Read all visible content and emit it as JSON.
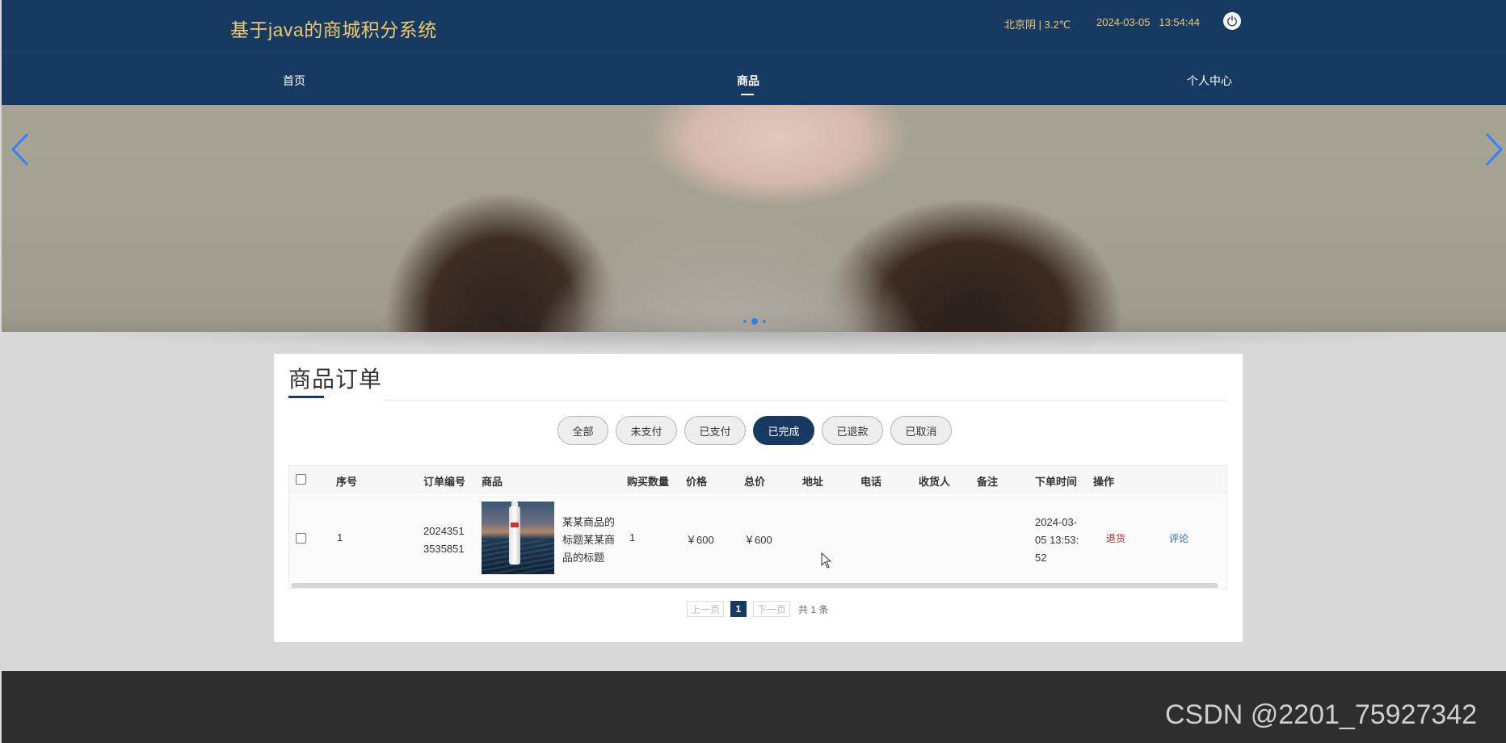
{
  "header": {
    "site_title": "基于java的商城积分系统",
    "weather": "北京阴 | 3.2℃",
    "datetime": "2024-03-05   13:54:44",
    "power_icon": "power-icon"
  },
  "nav": {
    "home": "首页",
    "goods": "商品",
    "user_center": "个人中心"
  },
  "banner": {
    "prev_icon": "chevron-left-icon",
    "next_icon": "chevron-right-icon",
    "slide_count": 3,
    "active_slide": 2
  },
  "orders": {
    "title": "商品订单",
    "filters": [
      "全部",
      "未支付",
      "已支付",
      "已完成",
      "已退款",
      "已取消"
    ],
    "active_filter": "已完成",
    "columns": [
      "序号",
      "订单编号",
      "商品",
      "购买数量",
      "价格",
      "总价",
      "地址",
      "电话",
      "收货人",
      "备注",
      "下单时间",
      "操作"
    ],
    "rows": [
      {
        "index": "1",
        "order_no_line1": "2024351",
        "order_no_line2": "3535851",
        "product_line1": "某某商品的",
        "product_line2": "标题某某商",
        "product_line3": "品的标题",
        "quantity": "1",
        "price": "￥600",
        "total": "￥600",
        "address": "",
        "phone": "",
        "receiver": "",
        "remark": "",
        "time_line1": "2024-03-",
        "time_line2": "05 13:53:",
        "time_line3": "52",
        "action_refund": "退货",
        "action_review": "评论"
      }
    ]
  },
  "pager": {
    "prev": "上一页",
    "current": "1",
    "next": "下一页",
    "total": "共 1 条"
  },
  "watermark": "CSDN @2201_75927342",
  "colors": {
    "primary": "#173a62",
    "accent_text": "#f0c96c",
    "refund": "#b03030",
    "review": "#2a6db5"
  }
}
